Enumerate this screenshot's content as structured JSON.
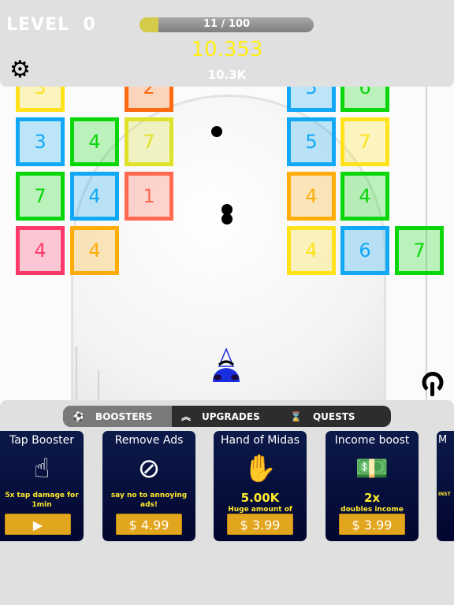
{
  "hud": {
    "level_label": "LEVEL",
    "level": "0",
    "progress_text": "11 / 100",
    "progress_fraction": 0.11,
    "score": "10.353",
    "income": "10.3K",
    "settings_icon": "gear-icon"
  },
  "colors": {
    "yellow": "#ffe21a",
    "green": "#0ad60a",
    "blue": "#12a8f5",
    "orange": "#ff6a10",
    "lime": "#dfe22a",
    "salmon": "#ff6a50",
    "pink": "#ff3a6a",
    "amber": "#ffad0a",
    "accent": "#e2a61e",
    "card_bg": "#0c1a4a"
  },
  "blocks": [
    [
      {
        "v": "3",
        "c": "yellow"
      },
      null,
      {
        "v": "2",
        "c": "orange"
      },
      null,
      null,
      {
        "v": "5",
        "c": "blue"
      },
      {
        "v": "6",
        "c": "green"
      }
    ],
    [
      {
        "v": "3",
        "c": "blue"
      },
      {
        "v": "4",
        "c": "green"
      },
      {
        "v": "7",
        "c": "lime"
      },
      null,
      null,
      {
        "v": "5",
        "c": "blue"
      },
      {
        "v": "7",
        "c": "yellow"
      }
    ],
    [
      {
        "v": "7",
        "c": "green"
      },
      {
        "v": "4",
        "c": "blue"
      },
      {
        "v": "1",
        "c": "salmon"
      },
      null,
      null,
      {
        "v": "4",
        "c": "amber"
      },
      {
        "v": "4",
        "c": "green"
      }
    ],
    [
      {
        "v": "4",
        "c": "pink"
      },
      {
        "v": "4",
        "c": "amber"
      },
      null,
      null,
      null,
      {
        "v": "4",
        "c": "yellow"
      },
      {
        "v": "6",
        "c": "blue"
      },
      {
        "v": "7",
        "c": "green"
      }
    ]
  ],
  "tabs": [
    {
      "label": "BOOSTERS",
      "icon": "boosters-icon",
      "active": true
    },
    {
      "label": "UPGRADES",
      "icon": "chevrons-up-icon"
    },
    {
      "label": "QUESTS",
      "icon": "hourglass-clock-icon"
    }
  ],
  "cards": [
    {
      "title": "Tap Booster",
      "icon": "tap-hand-icon",
      "glyph": "☝",
      "amount": "",
      "desc": "5x tap damage for 1min",
      "button": "▶",
      "button_icon": "video-ad-icon"
    },
    {
      "title": "Remove Ads",
      "icon": "no-ads-icon",
      "glyph": "⊘",
      "amount": "",
      "desc": "say no to annoying ads!",
      "button": "$ 4.99"
    },
    {
      "title": "Hand of Midas",
      "icon": "hand-coins-icon",
      "glyph": "✋",
      "amount": "5.00K",
      "desc": "Huge amount of money",
      "button": "$ 3.99"
    },
    {
      "title": "Income boost",
      "icon": "hand-money-icon",
      "glyph": "💵",
      "amount": "2x",
      "desc": "doubles income FOREVER",
      "button": "$ 3.99"
    },
    {
      "title": "M",
      "icon": "",
      "glyph": "",
      "amount": "",
      "desc": "INST",
      "button": ""
    }
  ]
}
